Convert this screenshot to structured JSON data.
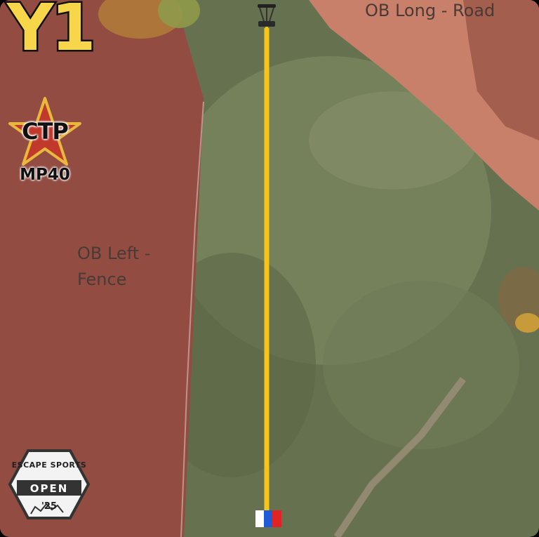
{
  "hole": {
    "title": "Y1"
  },
  "badge": {
    "ctp_label": "CTP",
    "disc": "MP40",
    "star_color": "#c0392b",
    "gold": "#e8b93c"
  },
  "zones": {
    "ob_long": "OB Long - Road",
    "ob_left_line1": "OB Left -",
    "ob_left_line2": "Fence"
  },
  "logo": {
    "brand": "ESCAPE SPORTS",
    "event": "OPEN",
    "year": "'25"
  },
  "colors": {
    "fairway_line": "#f5c518",
    "ob_red": "#8e4a3f",
    "road": "#c9806a",
    "grass": "#6d7a55",
    "tee_blue": "#1f5bd6",
    "tee_red": "#e02424"
  },
  "icons": [
    "basket-icon",
    "tee-marker-icon",
    "star-icon"
  ]
}
